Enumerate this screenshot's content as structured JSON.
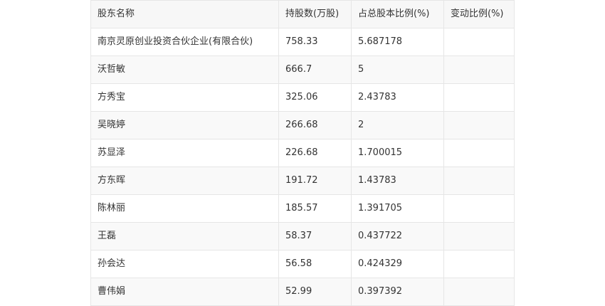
{
  "table": {
    "headers": [
      "股东名称",
      "持股数(万股)",
      "占总股本比例(%)",
      "变动比例(%)"
    ],
    "rows": [
      [
        "南京灵原创业投资合伙企业(有限合伙)",
        "758.33",
        "5.687178",
        ""
      ],
      [
        "沃哲敏",
        "666.7",
        "5",
        ""
      ],
      [
        "方秀宝",
        "325.06",
        "2.43783",
        ""
      ],
      [
        "吴晓婷",
        "266.68",
        "2",
        ""
      ],
      [
        "苏显泽",
        "226.68",
        "1.700015",
        ""
      ],
      [
        "方东晖",
        "191.72",
        "1.43783",
        ""
      ],
      [
        "陈林丽",
        "185.57",
        "1.391705",
        ""
      ],
      [
        "王磊",
        "58.37",
        "0.437722",
        ""
      ],
      [
        "孙会达",
        "56.58",
        "0.424329",
        ""
      ],
      [
        "曹伟娟",
        "52.99",
        "0.397392",
        ""
      ]
    ]
  }
}
